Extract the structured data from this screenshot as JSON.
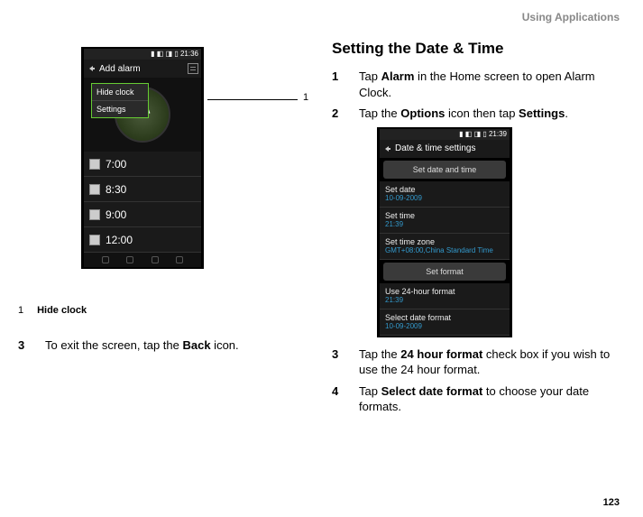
{
  "header": {
    "section": "Using Applications"
  },
  "page_number": "123",
  "left": {
    "phone": {
      "status_time": "21:36",
      "title": "Add alarm",
      "popup": {
        "item1": "Hide clock",
        "item2": "Settings"
      },
      "alarms": [
        {
          "time": "7:00",
          "sub": ""
        },
        {
          "time": "8:30",
          "sub": ""
        },
        {
          "time": "9:00",
          "sub": ""
        },
        {
          "time": "12:00",
          "sub": ""
        }
      ]
    },
    "callout": {
      "label": "1"
    },
    "legend": {
      "num": "1",
      "text": "Hide clock"
    },
    "step3": {
      "n": "3",
      "pre": "To exit the screen, tap the ",
      "bold": "Back",
      "post": " icon."
    }
  },
  "right": {
    "heading": "Setting the Date & Time",
    "step1": {
      "n": "1",
      "pre": "Tap ",
      "b1": "Alarm",
      "post": " in the Home screen to open Alarm Clock."
    },
    "step2": {
      "n": "2",
      "pre": "Tap the ",
      "b1": "Options",
      "mid": " icon then tap ",
      "b2": "Settings",
      "post": "."
    },
    "phone": {
      "status_time": "21:39",
      "title": "Date & time settings",
      "btn_setdt": "Set date and time",
      "rows": {
        "date": {
          "lbl": "Set date",
          "val": "10-09-2009"
        },
        "time": {
          "lbl": "Set time",
          "val": "21:39"
        },
        "tz": {
          "lbl": "Set time zone",
          "val": "GMT+08:00,China Standard Time"
        }
      },
      "btn_setfmt": "Set format",
      "rows2": {
        "use24": {
          "lbl": "Use 24-hour format",
          "val": "21:39"
        },
        "seldf": {
          "lbl": "Select date format",
          "val": "10-09-2009"
        }
      }
    },
    "step3": {
      "n": "3",
      "pre": "Tap the ",
      "b1": "24 hour format",
      "post": " check box if you wish to use the 24 hour format."
    },
    "step4": {
      "n": "4",
      "pre": "Tap ",
      "b1": "Select date format",
      "post": " to choose your date formats."
    }
  }
}
